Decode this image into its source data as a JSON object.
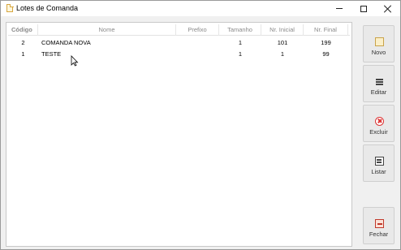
{
  "window": {
    "title": "Lotes de Comanda",
    "controls": {
      "minimize": "minimize",
      "maximize": "maximize",
      "close": "close"
    }
  },
  "grid": {
    "columns": [
      "Código",
      "Nome",
      "Prefixo",
      "Tamanho",
      "Nr. Inicial",
      "Nr. Final"
    ],
    "rows": [
      {
        "codigo": "2",
        "nome": "COMANDA NOVA",
        "prefixo": "",
        "tamanho": "1",
        "inicial": "101",
        "final": "199"
      },
      {
        "codigo": "1",
        "nome": "TESTE",
        "prefixo": "",
        "tamanho": "1",
        "inicial": "1",
        "final": "99"
      }
    ]
  },
  "sidebar": {
    "novo": {
      "label": "Novo",
      "icon": "new-document-icon"
    },
    "editar": {
      "label": "Editar",
      "icon": "edit-list-icon"
    },
    "excluir": {
      "label": "Excluir",
      "icon": "delete-icon"
    },
    "listar": {
      "label": "Listar",
      "icon": "print-list-icon"
    },
    "fechar": {
      "label": "Fechar",
      "icon": "exit-icon"
    }
  },
  "colors": {
    "window_bg": "#f0f0f0",
    "header_text": "#8a8a8a",
    "delete_red": "#dd3333"
  }
}
